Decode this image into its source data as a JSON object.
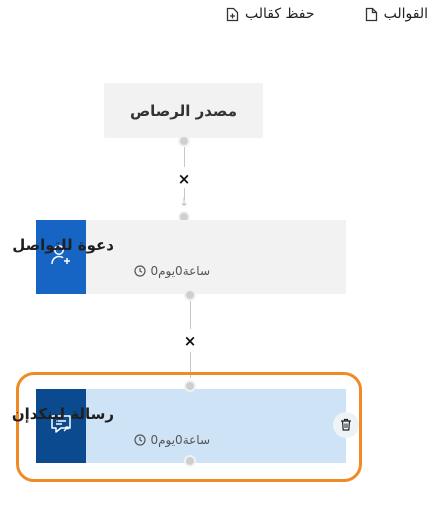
{
  "toolbar": {
    "templates_label": "القوالب",
    "save_as_template_label": "حفظ كقالب"
  },
  "source_node": {
    "title": "مصدر الرصاص"
  },
  "connectors": {
    "remove_symbol": "×",
    "arrow_symbol": "↓"
  },
  "steps": [
    {
      "title": "دعوة للتواصل",
      "delay": "ساعة0يوم0",
      "icon": "add-user-icon",
      "accent_color": "#1664c4"
    },
    {
      "title": "رسالة لينكدإن",
      "delay": "ساعة0يوم0",
      "icon": "message-icon",
      "accent_color": "#0b4a8f",
      "selected": true,
      "selection_color": "#f08a24"
    }
  ]
}
